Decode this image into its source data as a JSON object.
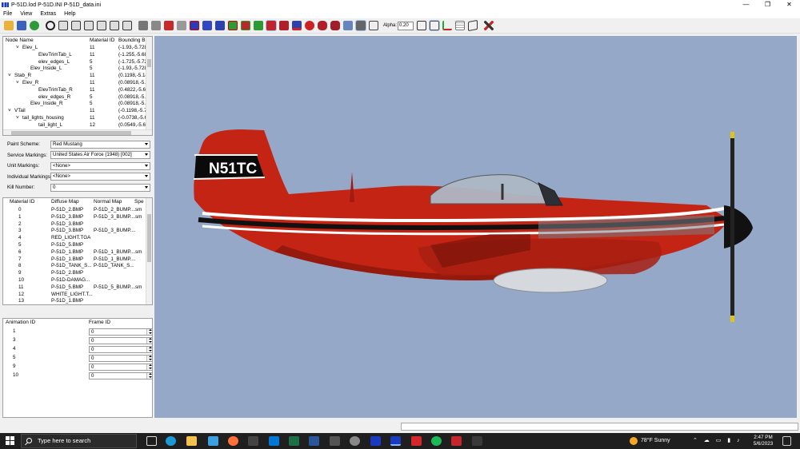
{
  "window": {
    "title": "P-51D.lod  P-51D.INI  P-51D_data.ini"
  },
  "window_controls": {
    "minimize": "—",
    "maximize": "❐",
    "close": "✕"
  },
  "menu": [
    "File",
    "View",
    "Extras",
    "Help"
  ],
  "toolbar": {
    "alpha_label": "Alpha:",
    "alpha_value": "0.20"
  },
  "node_tree": {
    "headers": [
      "Node Name",
      "Material ID",
      "Bounding B"
    ],
    "rows": [
      {
        "expander": "˅",
        "indent": 2,
        "name": "Elev_L",
        "material": "11",
        "bounds": "(-1.93,-5.728"
      },
      {
        "expander": "",
        "indent": 4,
        "name": "ElevTrimTab_L",
        "material": "11",
        "bounds": "(-1.255,-5.68"
      },
      {
        "expander": "",
        "indent": 4,
        "name": "elev_edges_L",
        "material": "5",
        "bounds": "(-1.725,-5.72"
      },
      {
        "expander": "",
        "indent": 3,
        "name": "Elev_Inside_L",
        "material": "5",
        "bounds": "(-1.93,-5.728"
      },
      {
        "expander": "˅",
        "indent": 1,
        "name": "Stab_R",
        "material": "11",
        "bounds": "(0.1198,-5.14"
      },
      {
        "expander": "˅",
        "indent": 2,
        "name": "Elev_R",
        "material": "11",
        "bounds": "(0.08918,-5.7"
      },
      {
        "expander": "",
        "indent": 4,
        "name": "ElevTrimTab_R",
        "material": "11",
        "bounds": "(0.4822,-5.68"
      },
      {
        "expander": "",
        "indent": 4,
        "name": "elev_edges_R",
        "material": "5",
        "bounds": "(0.08918,-5.7"
      },
      {
        "expander": "",
        "indent": 3,
        "name": "Elev_Inside_R",
        "material": "5",
        "bounds": "(0.08918,-5.7"
      },
      {
        "expander": "˅",
        "indent": 1,
        "name": "VTail",
        "material": "11",
        "bounds": "(-0.1198,-5.7"
      },
      {
        "expander": "˅",
        "indent": 2,
        "name": "tail_lights_housing",
        "material": "11",
        "bounds": "(-0.0738,-5.6"
      },
      {
        "expander": "",
        "indent": 4,
        "name": "tail_light_L",
        "material": "12",
        "bounds": "(0.0549,-5.62"
      }
    ]
  },
  "properties": [
    {
      "label": "Paint Scheme:",
      "value": "Red Mustang"
    },
    {
      "label": "Service Markings:",
      "value": "United States Air Force (1948) [002]"
    },
    {
      "label": "Unit Markings:",
      "value": "<None>"
    },
    {
      "label": "Individual Markings:",
      "value": "<None>"
    },
    {
      "label": "Kill Number:",
      "value": "0"
    }
  ],
  "material_table": {
    "headers": [
      "Material ID",
      "Diffuse Map",
      "Normal Map",
      "Spe"
    ],
    "rows": [
      {
        "id": "0",
        "diffuse": "P-51D_2.BMP",
        "normal": "P-51D_2_BUMP....",
        "spec": "sm"
      },
      {
        "id": "1",
        "diffuse": "P-51D_3.BMP",
        "normal": "P-51D_3_BUMP....",
        "spec": "sm"
      },
      {
        "id": "2",
        "diffuse": "P-51D_3.BMP",
        "normal": "",
        "spec": ""
      },
      {
        "id": "3",
        "diffuse": "P-51D_3.BMP",
        "normal": "P-51D_3_BUMP....",
        "spec": ""
      },
      {
        "id": "4",
        "diffuse": "RED_LIGHT.TGA",
        "normal": "",
        "spec": ""
      },
      {
        "id": "5",
        "diffuse": "P-51D_5.BMP",
        "normal": "",
        "spec": ""
      },
      {
        "id": "6",
        "diffuse": "P-51D_1.BMP",
        "normal": "P-51D_1_BUMP....",
        "spec": "sm"
      },
      {
        "id": "7",
        "diffuse": "P-51D_1.BMP",
        "normal": "P-51D_1_BUMP....",
        "spec": ""
      },
      {
        "id": "8",
        "diffuse": "P-51D_TANK_S...",
        "normal": "P-51D_TANK_S...",
        "spec": ""
      },
      {
        "id": "9",
        "diffuse": "P-51D_2.BMP",
        "normal": "",
        "spec": ""
      },
      {
        "id": "10",
        "diffuse": "P-51D-DAMAG...",
        "normal": "",
        "spec": ""
      },
      {
        "id": "11",
        "diffuse": "P-51D_5.BMP",
        "normal": "P-51D_5_BUMP....",
        "spec": "sm"
      },
      {
        "id": "12",
        "diffuse": "WHITE_LIGHT.T...",
        "normal": "",
        "spec": ""
      },
      {
        "id": "13",
        "diffuse": "P-51D_1.BMP",
        "normal": "",
        "spec": ""
      }
    ]
  },
  "animation_table": {
    "headers": [
      "Animation ID",
      "Frame ID"
    ],
    "rows": [
      {
        "id": "1",
        "frame": "0"
      },
      {
        "id": "3",
        "frame": "0"
      },
      {
        "id": "4",
        "frame": "0"
      },
      {
        "id": "5",
        "frame": "0"
      },
      {
        "id": "9",
        "frame": "0"
      },
      {
        "id": "10",
        "frame": "0"
      }
    ]
  },
  "viewport": {
    "tail_marking": "N51TC",
    "background": "#95a8c8",
    "paint_color": "#c42413"
  },
  "taskbar": {
    "search_placeholder": "Type here to search",
    "weather": "78°F  Sunny",
    "time": "2:47 PM",
    "date": "5/6/2023"
  }
}
